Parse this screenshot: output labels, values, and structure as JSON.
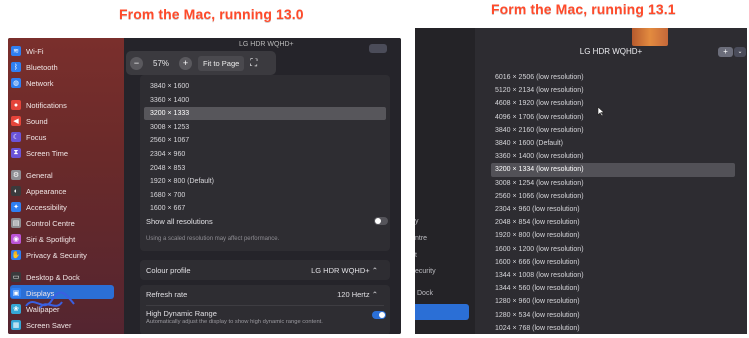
{
  "captions": {
    "left": "From the Mac, running 13.0",
    "right": "Form the Mac, running 13.1"
  },
  "left": {
    "sidebar": {
      "items": [
        {
          "label": "Wi-Fi",
          "icon": "wifi-icon",
          "color": "#2f7ff2"
        },
        {
          "label": "Bluetooth",
          "icon": "bluetooth-icon",
          "color": "#2f7ff2"
        },
        {
          "label": "Network",
          "icon": "network-icon",
          "color": "#2f7ff2"
        },
        {
          "label": "Notifications",
          "icon": "bell-icon",
          "color": "#e5443a"
        },
        {
          "label": "Sound",
          "icon": "speaker-icon",
          "color": "#e5443a"
        },
        {
          "label": "Focus",
          "icon": "moon-icon",
          "color": "#6b54d9"
        },
        {
          "label": "Screen Time",
          "icon": "hourglass-icon",
          "color": "#6b54d9"
        },
        {
          "label": "General",
          "icon": "gear-icon",
          "color": "#8e8e93"
        },
        {
          "label": "Appearance",
          "icon": "appearance-icon",
          "color": "#3a3a3c"
        },
        {
          "label": "Accessibility",
          "icon": "accessibility-icon",
          "color": "#2f7ff2"
        },
        {
          "label": "Control Centre",
          "icon": "control-centre-icon",
          "color": "#8e8e93"
        },
        {
          "label": "Siri & Spotlight",
          "icon": "siri-icon",
          "color": "#bb54d6"
        },
        {
          "label": "Privacy & Security",
          "icon": "hand-icon",
          "color": "#2f7ff2"
        },
        {
          "label": "Desktop & Dock",
          "icon": "dock-icon",
          "color": "#3a3a3c"
        },
        {
          "label": "Displays",
          "icon": "display-icon",
          "color": "#2f7ff2"
        },
        {
          "label": "Wallpaper",
          "icon": "wallpaper-icon",
          "color": "#35a7d6"
        },
        {
          "label": "Screen Saver",
          "icon": "screensaver-icon",
          "color": "#35a7d6"
        }
      ],
      "selected": "Displays"
    },
    "header_partial": "LG HDR WQHD+",
    "toolbar": {
      "zoom_out": "−",
      "zoom": "57%",
      "zoom_in": "+",
      "fit": "Fit to Page",
      "fullscreen": "⛶"
    },
    "resolutions": [
      "3840 × 1600",
      "3360 × 1400",
      "3200 × 1333",
      "3008 × 1253",
      "2560 × 1067",
      "2304 × 960",
      "2048 × 853",
      "1920 × 800 (Default)",
      "1680 × 700",
      "1600 × 667"
    ],
    "selected_resolution": "3200 × 1333",
    "show_all_label": "Show all resolutions",
    "hint": "Using a scaled resolution may affect performance.",
    "colour_profile_label": "Colour profile",
    "colour_profile_value": "LG HDR WQHD+ ⌃",
    "refresh_label": "Refresh rate",
    "refresh_value": "120 Hertz ⌃",
    "hdr_label": "High Dynamic Range",
    "hdr_desc": "Automatically adjust the display to show high dynamic range content.",
    "accent": "#2b6fd6"
  },
  "right": {
    "monitor_name": "LG HDR WQHD+",
    "add_button": "+",
    "add_menu": "⌄",
    "sidebar_fragments": [
      "y",
      "ntre",
      "t",
      "ecurity",
      "Dock"
    ],
    "resolutions": [
      "6016 × 2506 (low resolution)",
      "5120 × 2134 (low resolution)",
      "4608 × 1920 (low resolution)",
      "4096 × 1706 (low resolution)",
      "3840 × 2160 (low resolution)",
      "3840 × 1600 (Default)",
      "3360 × 1400 (low resolution)",
      "3200 × 1334 (low resolution)",
      "3008 × 1254 (low resolution)",
      "2560 × 1066 (low resolution)",
      "2304 × 960 (low resolution)",
      "2048 × 854 (low resolution)",
      "1920 × 800 (low resolution)",
      "1600 × 1200 (low resolution)",
      "1600 × 666 (low resolution)",
      "1344 × 1008 (low resolution)",
      "1344 × 560 (low resolution)",
      "1280 × 960 (low resolution)",
      "1280 × 534 (low resolution)",
      "1024 × 768 (low resolution)"
    ],
    "selected_resolution": "3200 × 1334 (low resolution)"
  }
}
